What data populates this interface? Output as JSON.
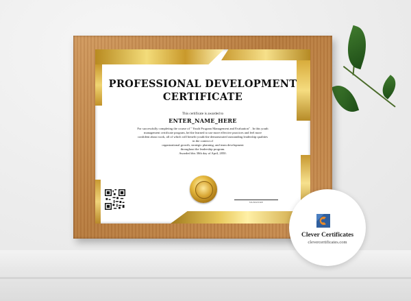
{
  "certificate": {
    "title_line1": "PROFESSIONAL DEVELOPMENT",
    "title_line2": "CERTIFICATE",
    "awarded_to": "This certificate is awarded to",
    "recipient": "ENTER_NAME_HERE",
    "body_lines": [
      "For successfully completing the course of \" Youth Program Management and Evaluation\" . In this youth",
      "management certificate program, he/she learned to use more effective practices and feel more",
      "confident about work, all of which will benefit youth/she demonstrated outstanding leadership qualities",
      "in the context of",
      "organizational growth, strategic planning, and team development",
      "throughout the leadership program.",
      "Awarded this 30th day of April, 2050."
    ],
    "signature_label": "SIGNATURE"
  },
  "badge": {
    "brand_name": "Clever Certificates",
    "url": "clevercertificates.com",
    "logo_colors": [
      "#2f5f9e",
      "#e88a2a"
    ]
  },
  "colors": {
    "frame_wood": "#c38a4d",
    "gold_accent": "#e6c15a",
    "leaf_green": "#2e6622"
  }
}
